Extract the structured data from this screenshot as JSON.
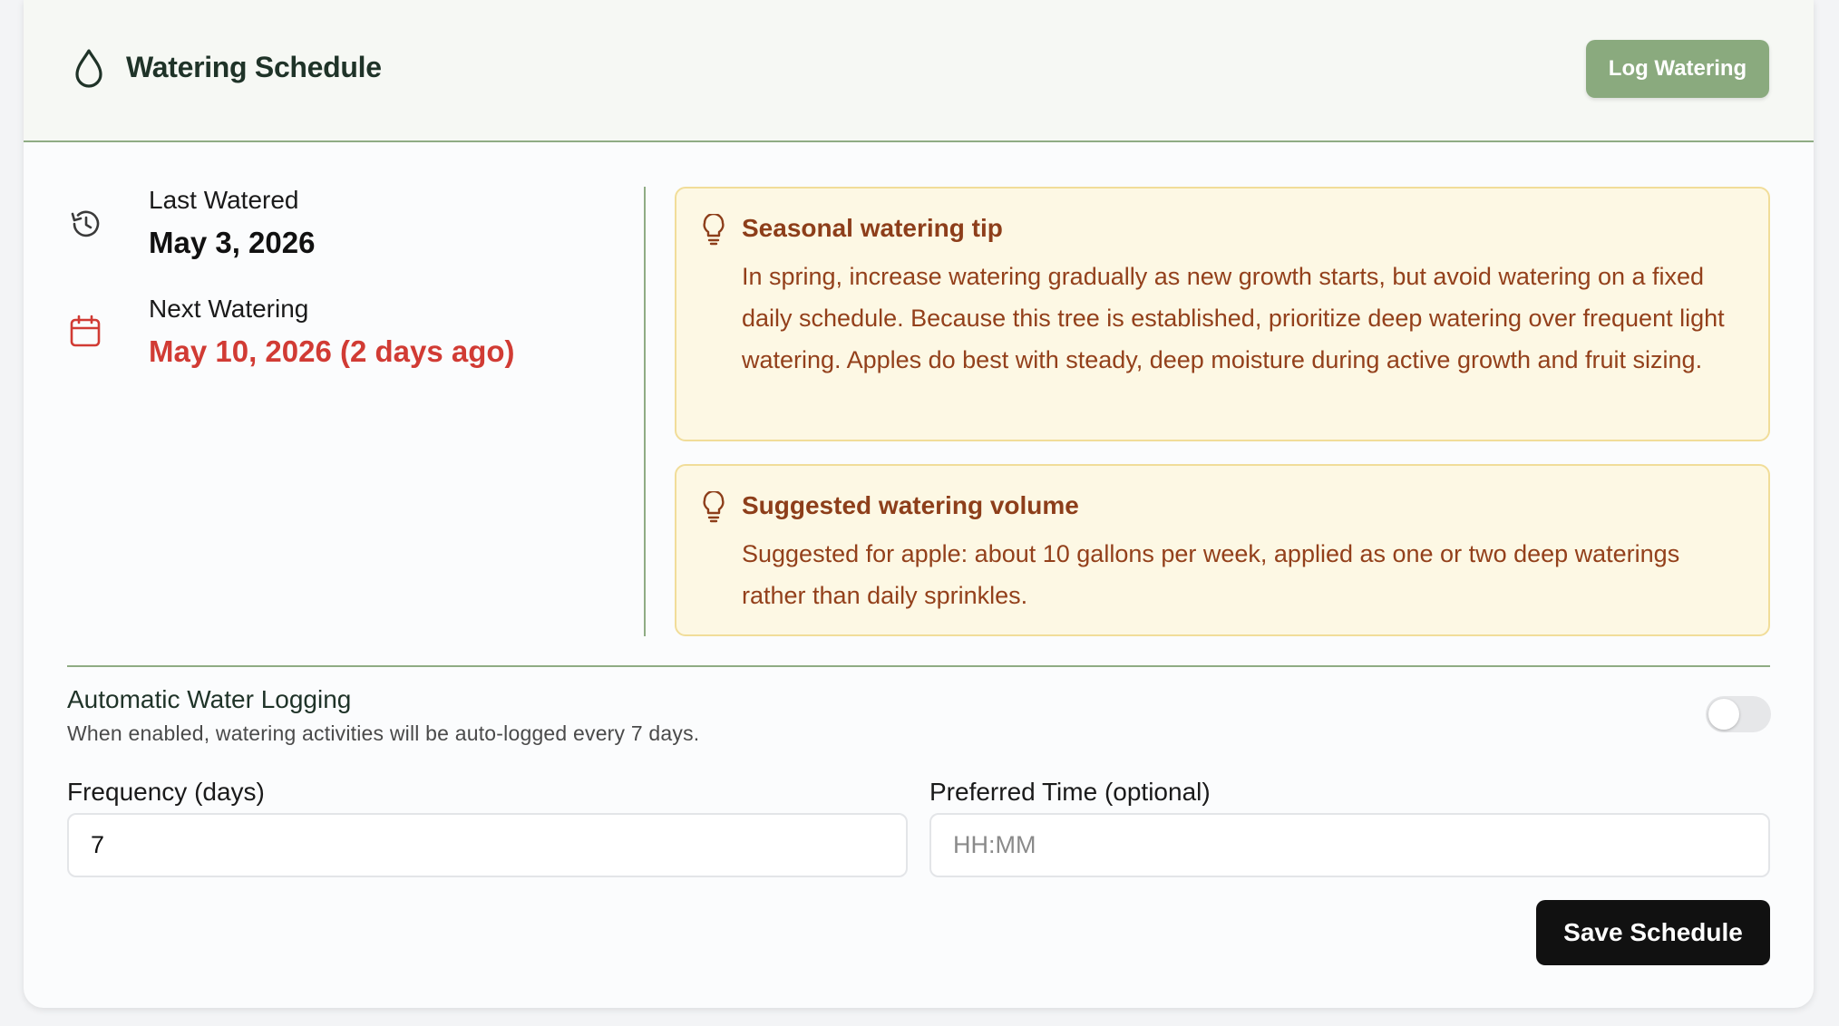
{
  "header": {
    "title": "Watering Schedule",
    "log_button": "Log Watering",
    "icon": "droplet-icon"
  },
  "status": {
    "last_watered_label": "Last Watered",
    "last_watered_value": "May 3, 2026",
    "last_watered_icon": "history-icon",
    "next_watering_label": "Next Watering",
    "next_watering_value": "May 10, 2026 (2 days ago)",
    "next_watering_icon": "calendar-icon",
    "overdue_color": "#d13b34"
  },
  "tips": [
    {
      "icon": "lightbulb-icon",
      "title": "Seasonal watering tip",
      "text": "In spring, increase watering gradually as new growth starts, but avoid watering on a fixed daily schedule. Because this tree is established, prioritize deep watering over frequent light watering. Apples do best with steady, deep moisture during active growth and fruit sizing."
    },
    {
      "icon": "lightbulb-icon",
      "title": "Suggested watering volume",
      "text": "Suggested for apple: about 10 gallons per week, applied as one or two deep waterings rather than daily sprinkles."
    }
  ],
  "auto_logging": {
    "title": "Automatic Water Logging",
    "description": "When enabled, watering activities will be auto-logged every 7 days.",
    "enabled": false
  },
  "form": {
    "frequency_label": "Frequency (days)",
    "frequency_value": "7",
    "time_label": "Preferred Time (optional)",
    "time_placeholder": "HH:MM",
    "time_value": "",
    "save_button": "Save Schedule"
  },
  "colors": {
    "accent_green": "#8aaa7e",
    "tip_background": "#fdf8e4",
    "tip_border": "#f1dd99",
    "tip_text": "#93401b"
  }
}
